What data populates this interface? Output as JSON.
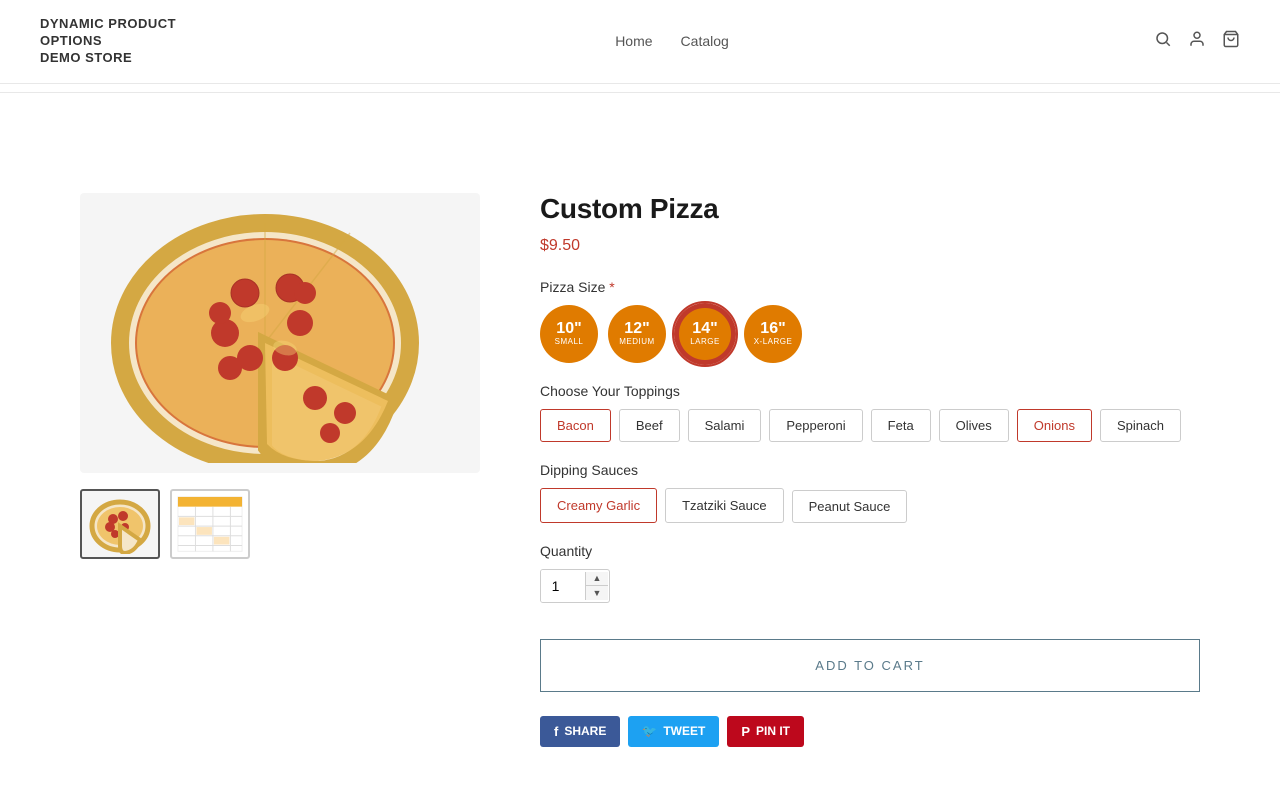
{
  "header": {
    "store_name": "DYNAMIC PRODUCT OPTIONS\nDEMO STORE",
    "nav": [
      {
        "label": "Home",
        "id": "home"
      },
      {
        "label": "Catalog",
        "id": "catalog"
      }
    ],
    "icons": {
      "search": "🔍",
      "login": "👤",
      "cart": "🛒"
    }
  },
  "product": {
    "title": "Custom Pizza",
    "price": "$9.50",
    "size_label": "Pizza Size",
    "size_required": "*",
    "sizes": [
      {
        "num": "10\"",
        "sub": "SMALL",
        "id": "10"
      },
      {
        "num": "12\"",
        "sub": "MEDIUM",
        "id": "12"
      },
      {
        "num": "14\"",
        "sub": "LARGE",
        "id": "14",
        "selected": true
      },
      {
        "num": "16\"",
        "sub": "X-LARGE",
        "id": "16"
      }
    ],
    "toppings_label": "Choose Your Toppings",
    "toppings": [
      {
        "label": "Bacon",
        "id": "bacon",
        "selected": true
      },
      {
        "label": "Beef",
        "id": "beef"
      },
      {
        "label": "Salami",
        "id": "salami"
      },
      {
        "label": "Pepperoni",
        "id": "pepperoni"
      },
      {
        "label": "Feta",
        "id": "feta"
      },
      {
        "label": "Olives",
        "id": "olives"
      },
      {
        "label": "Onions",
        "id": "onions",
        "selected": true
      },
      {
        "label": "Spinach",
        "id": "spinach"
      }
    ],
    "sauces_label": "Dipping Sauces",
    "sauces": [
      {
        "label": "Creamy Garlic",
        "id": "creamy-garlic",
        "selected": true
      },
      {
        "label": "Tzatziki Sauce",
        "id": "tzatziki"
      },
      {
        "label": "Peanut Sauce",
        "id": "peanut"
      }
    ],
    "quantity_label": "Quantity",
    "quantity_value": "1",
    "add_to_cart_label": "ADD TO CART",
    "social": [
      {
        "id": "share",
        "label": "SHARE",
        "type": "facebook"
      },
      {
        "id": "tweet",
        "label": "TWEET",
        "type": "twitter"
      },
      {
        "id": "pin",
        "label": "PIN IT",
        "type": "pinterest"
      }
    ]
  }
}
